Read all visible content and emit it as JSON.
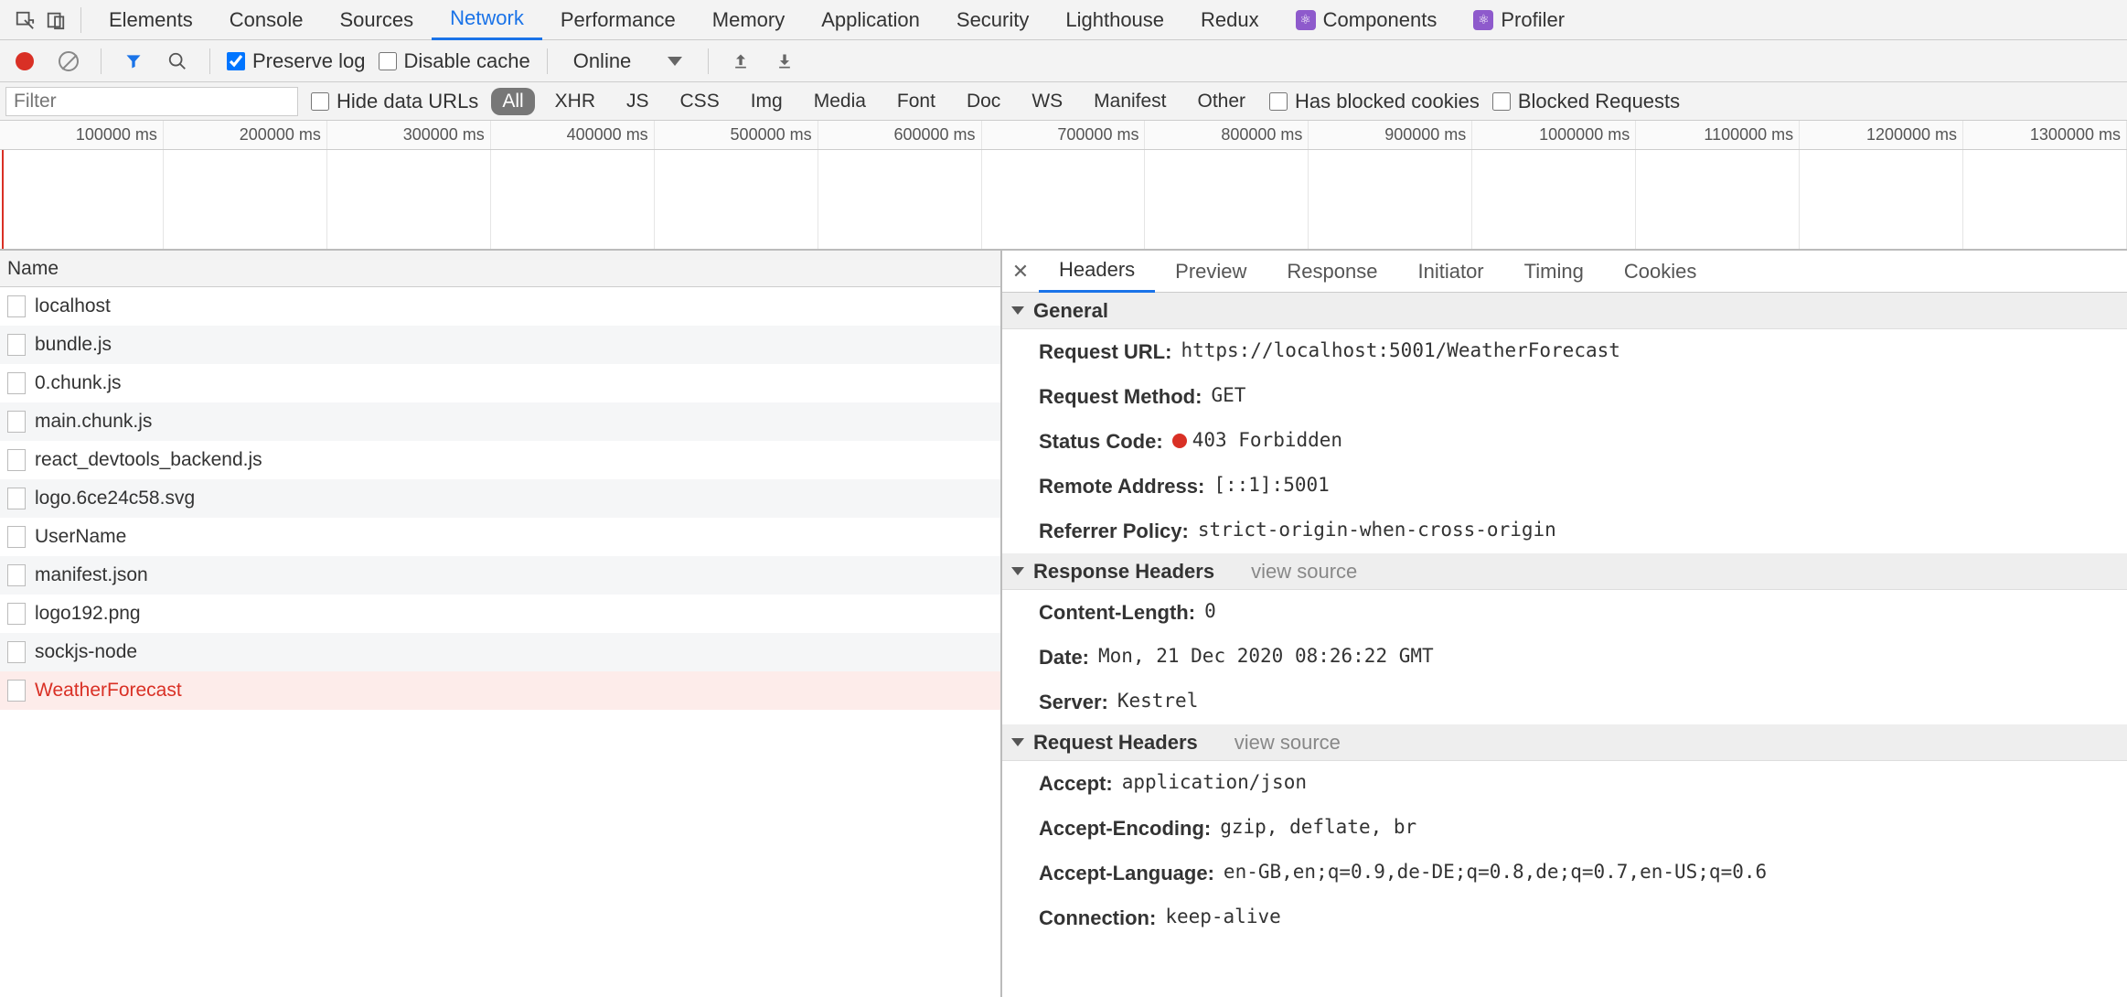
{
  "top_tabs": {
    "items": [
      "Elements",
      "Console",
      "Sources",
      "Network",
      "Performance",
      "Memory",
      "Application",
      "Security",
      "Lighthouse",
      "Redux",
      "Components",
      "Profiler"
    ],
    "active_index": 3,
    "ext_indices": [
      10,
      11
    ]
  },
  "toolbar": {
    "preserve_log_label": "Preserve log",
    "preserve_log_checked": true,
    "disable_cache_label": "Disable cache",
    "disable_cache_checked": false,
    "throttling_value": "Online"
  },
  "filter_row": {
    "filter_placeholder": "Filter",
    "hide_data_urls_label": "Hide data URLs",
    "types": [
      "All",
      "XHR",
      "JS",
      "CSS",
      "Img",
      "Media",
      "Font",
      "Doc",
      "WS",
      "Manifest",
      "Other"
    ],
    "type_active_index": 0,
    "has_blocked_cookies_label": "Has blocked cookies",
    "blocked_requests_label": "Blocked Requests"
  },
  "timeline": {
    "ticks": [
      "100000 ms",
      "200000 ms",
      "300000 ms",
      "400000 ms",
      "500000 ms",
      "600000 ms",
      "700000 ms",
      "800000 ms",
      "900000 ms",
      "1000000 ms",
      "1100000 ms",
      "1200000 ms",
      "1300000 ms"
    ]
  },
  "request_list": {
    "header": "Name",
    "items": [
      {
        "name": "localhost",
        "error": false
      },
      {
        "name": "bundle.js",
        "error": false
      },
      {
        "name": "0.chunk.js",
        "error": false
      },
      {
        "name": "main.chunk.js",
        "error": false
      },
      {
        "name": "react_devtools_backend.js",
        "error": false
      },
      {
        "name": "logo.6ce24c58.svg",
        "error": false
      },
      {
        "name": "UserName",
        "error": false
      },
      {
        "name": "manifest.json",
        "error": false
      },
      {
        "name": "logo192.png",
        "error": false
      },
      {
        "name": "sockjs-node",
        "error": false
      },
      {
        "name": "WeatherForecast",
        "error": true
      }
    ]
  },
  "detail": {
    "tabs": [
      "Headers",
      "Preview",
      "Response",
      "Initiator",
      "Timing",
      "Cookies"
    ],
    "active_index": 0,
    "sections": {
      "general": {
        "title": "General",
        "rows": [
          {
            "k": "Request URL:",
            "v": "https://localhost:5001/WeatherForecast"
          },
          {
            "k": "Request Method:",
            "v": "GET"
          },
          {
            "k": "Status Code:",
            "v": "403 Forbidden",
            "status": true
          },
          {
            "k": "Remote Address:",
            "v": "[::1]:5001"
          },
          {
            "k": "Referrer Policy:",
            "v": "strict-origin-when-cross-origin"
          }
        ]
      },
      "response_headers": {
        "title": "Response Headers",
        "view_source": "view source",
        "rows": [
          {
            "k": "Content-Length:",
            "v": "0"
          },
          {
            "k": "Date:",
            "v": "Mon, 21 Dec 2020 08:26:22 GMT"
          },
          {
            "k": "Server:",
            "v": "Kestrel"
          }
        ]
      },
      "request_headers": {
        "title": "Request Headers",
        "view_source": "view source",
        "rows": [
          {
            "k": "Accept:",
            "v": "application/json"
          },
          {
            "k": "Accept-Encoding:",
            "v": "gzip, deflate, br"
          },
          {
            "k": "Accept-Language:",
            "v": "en-GB,en;q=0.9,de-DE;q=0.8,de;q=0.7,en-US;q=0.6"
          },
          {
            "k": "Connection:",
            "v": "keep-alive"
          }
        ]
      }
    }
  }
}
